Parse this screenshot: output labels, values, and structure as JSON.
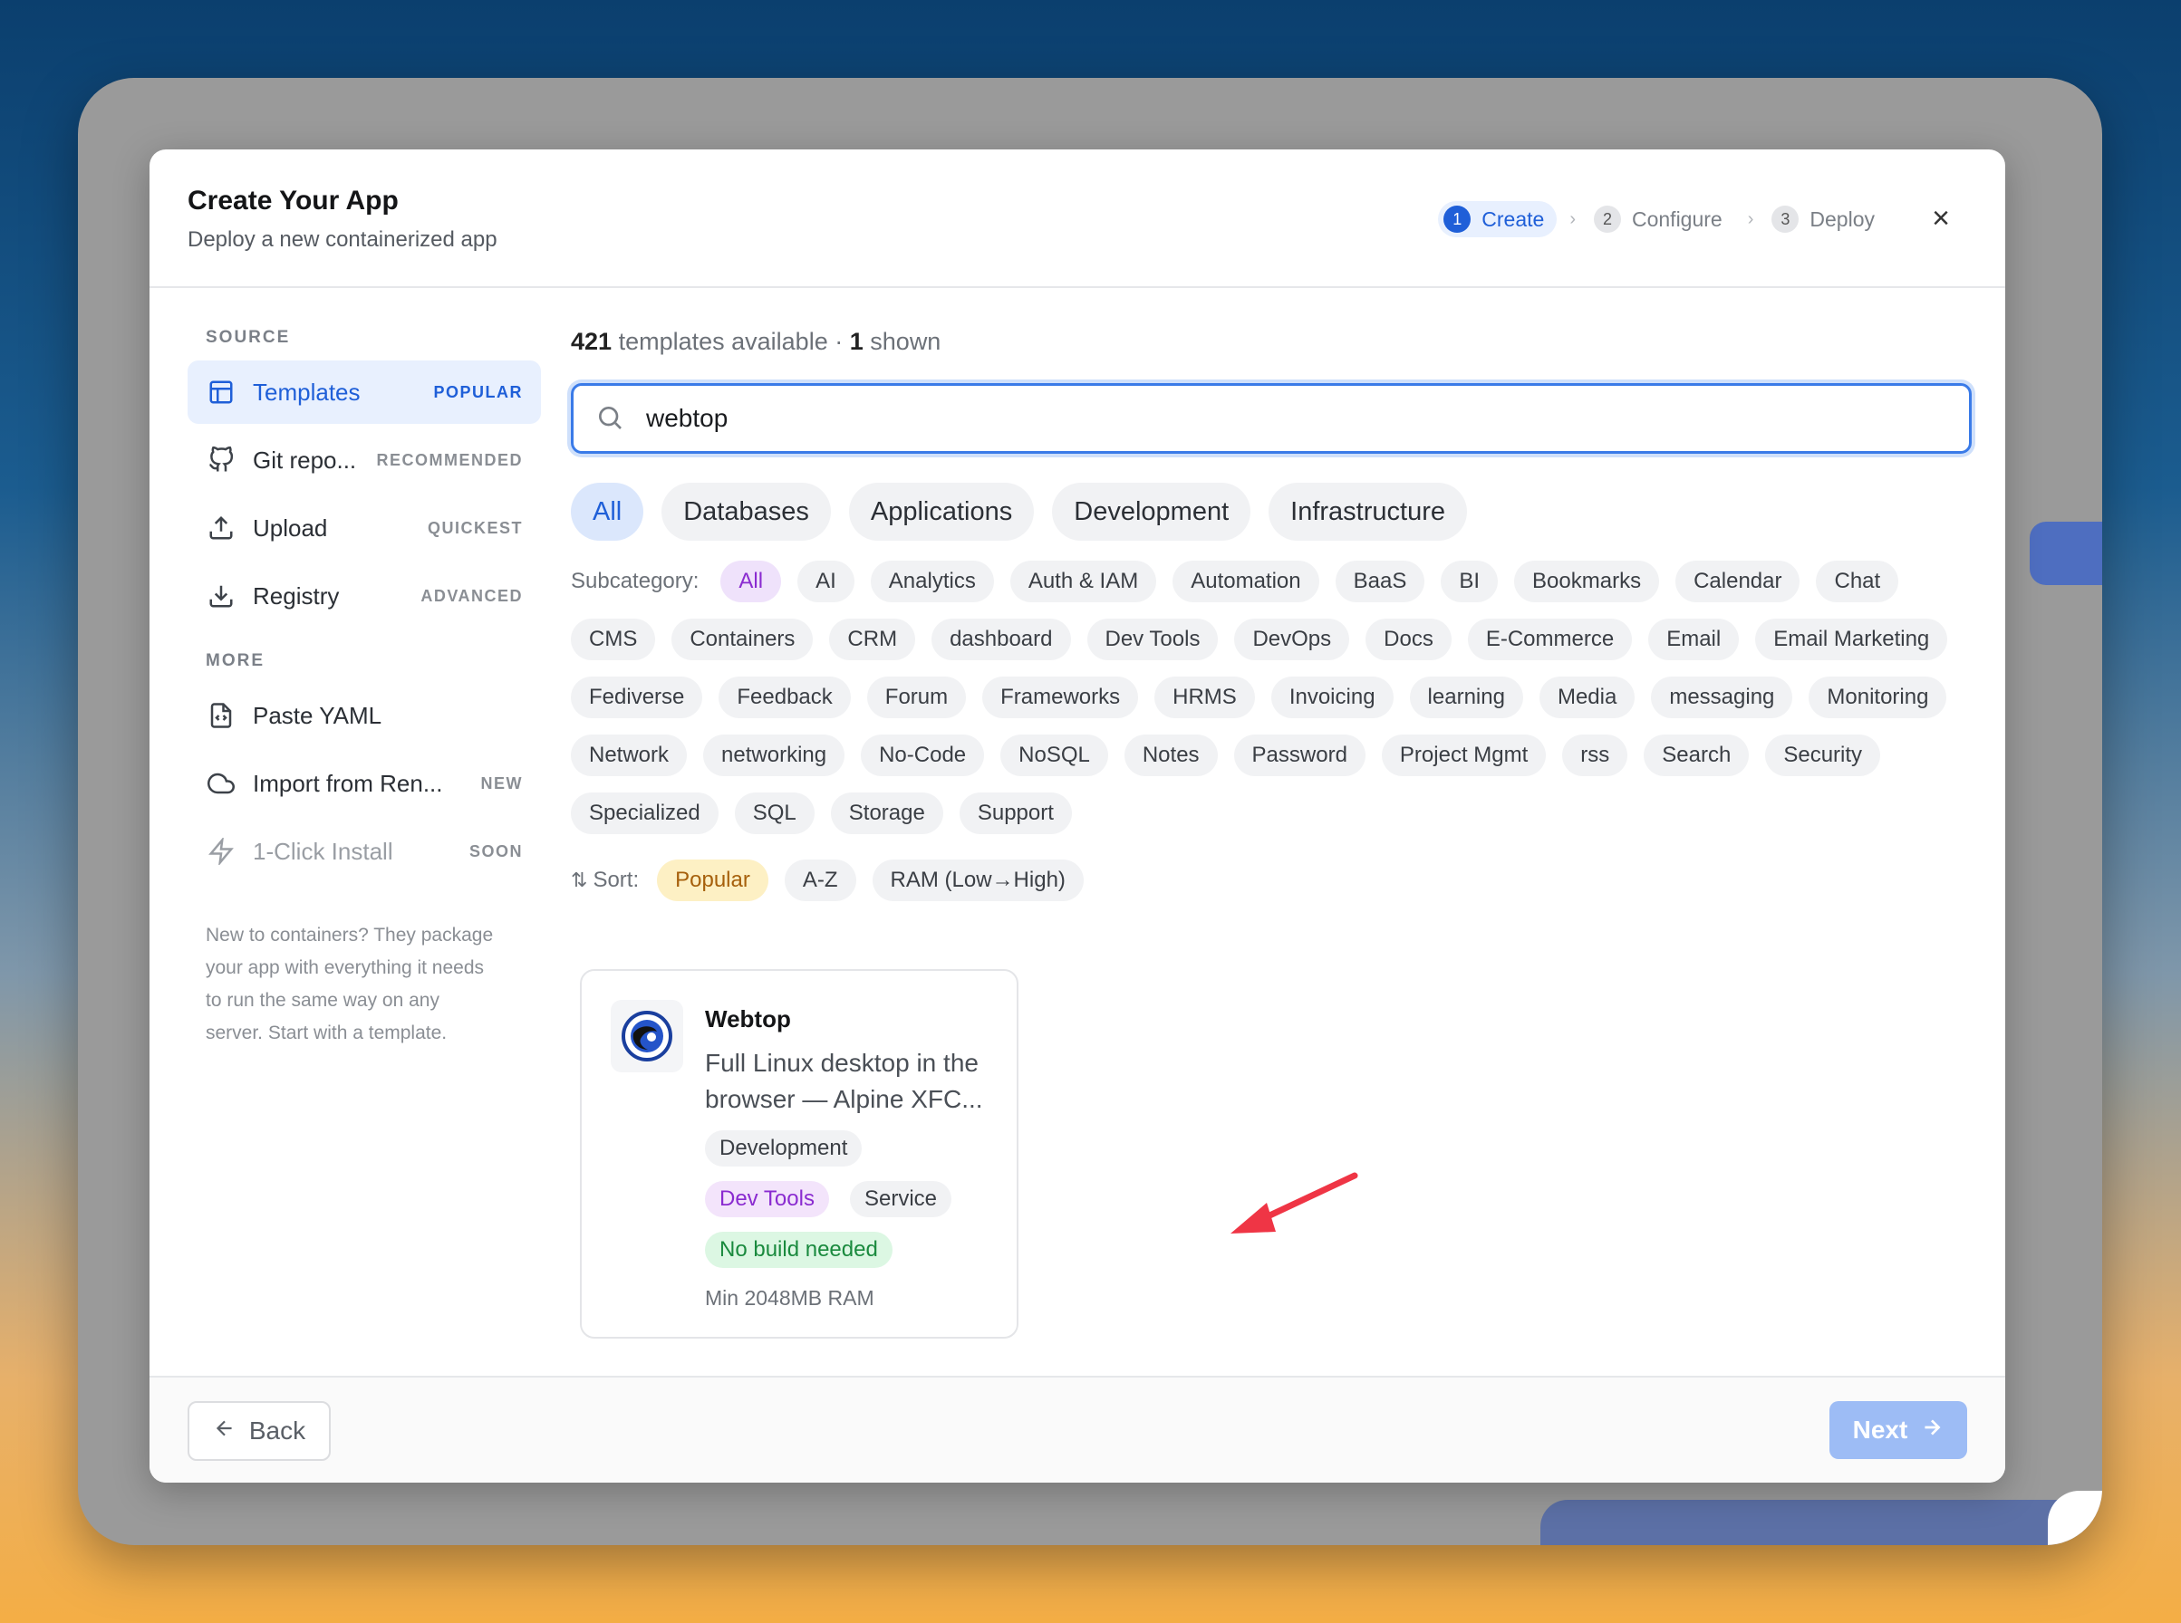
{
  "header": {
    "title": "Create Your App",
    "subtitle": "Deploy a new containerized app",
    "steps": [
      {
        "num": "1",
        "label": "Create"
      },
      {
        "num": "2",
        "label": "Configure"
      },
      {
        "num": "3",
        "label": "Deploy"
      }
    ],
    "step_sep": "›",
    "close": "×"
  },
  "sidebar": {
    "source_heading": "SOURCE",
    "items": [
      {
        "label": "Templates",
        "badge": "POPULAR",
        "icon": "template-icon"
      },
      {
        "label": "Git repo...",
        "badge": "RECOMMENDED",
        "icon": "github-icon"
      },
      {
        "label": "Upload",
        "badge": "QUICKEST",
        "icon": "upload-icon"
      },
      {
        "label": "Registry",
        "badge": "ADVANCED",
        "icon": "download-icon"
      }
    ],
    "more_heading": "MORE",
    "more_items": [
      {
        "label": "Paste YAML",
        "badge": "",
        "icon": "file-code-icon"
      },
      {
        "label": "Import from Ren...",
        "badge": "NEW",
        "icon": "cloud-icon"
      },
      {
        "label": "1-Click Install",
        "badge": "SOON",
        "icon": "lightning-icon"
      }
    ],
    "help": "New to containers? They package your app with everything it needs to run the same way on any server. Start with a template."
  },
  "main": {
    "count_total": "421",
    "count_text": "templates available ·",
    "count_shown": "1",
    "count_shown_text": "shown",
    "search": {
      "value": "webtop"
    },
    "categories": [
      "All",
      "Databases",
      "Applications",
      "Development",
      "Infrastructure"
    ],
    "subcategory_label": "Subcategory:",
    "subcategories": [
      "All",
      "AI",
      "Analytics",
      "Auth & IAM",
      "Automation",
      "BaaS",
      "BI",
      "Bookmarks",
      "Calendar",
      "Chat",
      "CMS",
      "Containers",
      "CRM",
      "dashboard",
      "Dev Tools",
      "DevOps",
      "Docs",
      "E-Commerce",
      "Email",
      "Email Marketing",
      "Fediverse",
      "Feedback",
      "Forum",
      "Frameworks",
      "HRMS",
      "Invoicing",
      "learning",
      "Media",
      "messaging",
      "Monitoring",
      "Network",
      "networking",
      "No-Code",
      "NoSQL",
      "Notes",
      "Password",
      "Project Mgmt",
      "rss",
      "Search",
      "Security",
      "Specialized",
      "SQL",
      "Storage",
      "Support"
    ],
    "sort_label": "Sort:",
    "sort_options": [
      "Popular",
      "A-Z",
      "RAM (Low→High)"
    ],
    "card": {
      "name": "Webtop",
      "description": "Full Linux desktop in the browser — Alpine XFC...",
      "tag_category": "Development",
      "tag_subcategory": "Dev Tools",
      "tag_type": "Service",
      "tag_build": "No build needed",
      "ram": "Min 2048MB RAM"
    }
  },
  "footer": {
    "back": "Back",
    "next": "Next"
  },
  "colors": {
    "accent": "#1f5fd8",
    "annotation_arrow": "#ef3545"
  }
}
